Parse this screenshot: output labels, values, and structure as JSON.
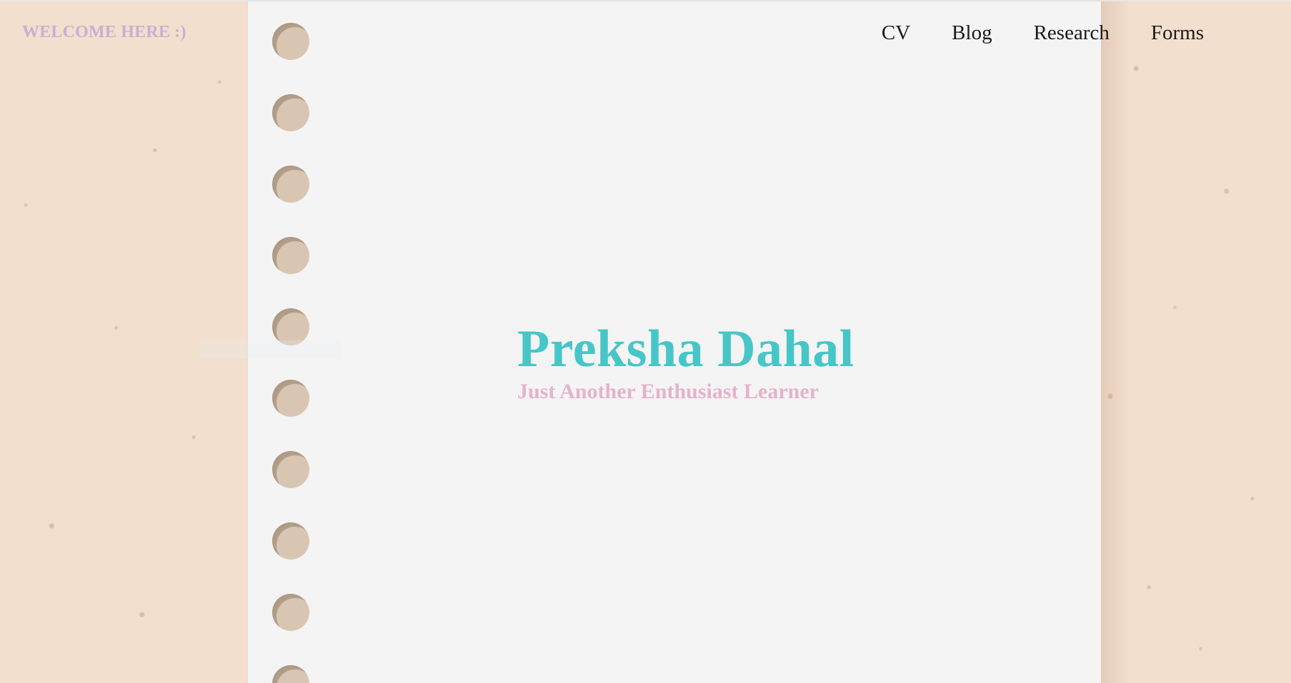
{
  "header": {
    "welcome_text": "WELCOME HERE :)"
  },
  "nav": {
    "items": [
      {
        "label": "CV"
      },
      {
        "label": "Blog"
      },
      {
        "label": "Research"
      },
      {
        "label": "Forms"
      }
    ]
  },
  "hero": {
    "name": "Preksha Dahal",
    "tagline": "Just Another Enthusiast Learner"
  },
  "colors": {
    "background": "#f2dfcd",
    "paper": "#f4f4f4",
    "welcome": "#c9aed6",
    "name": "#47c6c8",
    "tagline": "#e5b3c9",
    "nav_text": "#1a1a1a",
    "hole": "#d8c6b3"
  },
  "decor": {
    "binder_hole_count": 10
  }
}
